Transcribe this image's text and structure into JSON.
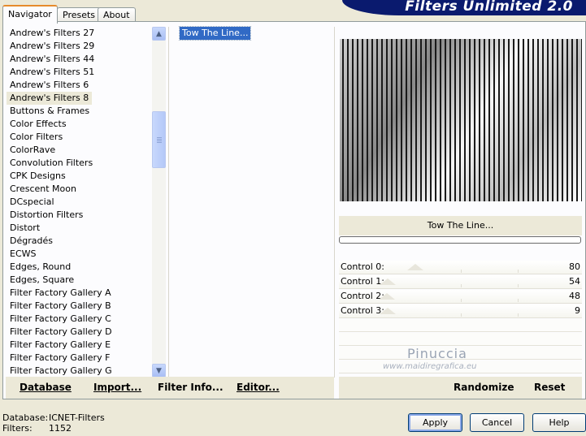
{
  "tabs": [
    {
      "label": "Navigator"
    },
    {
      "label": "Presets"
    },
    {
      "label": "About"
    }
  ],
  "banner": {
    "title": "Filters Unlimited 2.0"
  },
  "categories": [
    "Andrew's Filters 27",
    "Andrew's Filters 29",
    "Andrew's Filters 44",
    "Andrew's Filters 51",
    "Andrew's Filters 6",
    "Andrew's Filters 8",
    "Buttons & Frames",
    "Color Effects",
    "Color Filters",
    "ColorRave",
    "Convolution Filters",
    "CPK Designs",
    "Crescent Moon",
    "DCspecial",
    "Distortion Filters",
    "Distort",
    "Dégradés",
    "ECWS",
    "Edges, Round",
    "Edges, Square",
    "Filter Factory Gallery A",
    "Filter Factory Gallery B",
    "Filter Factory Gallery C",
    "Filter Factory Gallery D",
    "Filter Factory Gallery E",
    "Filter Factory Gallery F",
    "Filter Factory Gallery G"
  ],
  "selected_category": "Andrew's Filters 8",
  "filter_list": {
    "selected": "Tow The Line..."
  },
  "preview": {
    "filter_name": "Tow The Line..."
  },
  "controls": [
    {
      "label": "Control 0:",
      "value": "80"
    },
    {
      "label": "Control 1:",
      "value": "54"
    },
    {
      "label": "Control 2:",
      "value": "48"
    },
    {
      "label": "Control 3:",
      "value": "9"
    }
  ],
  "watermark": {
    "name": "Pinuccia",
    "site": "www.maidiregrafica.eu"
  },
  "left_buttons": {
    "database": "Database",
    "import": "Import...",
    "filter_info": "Filter Info...",
    "editor": "Editor..."
  },
  "right_buttons": {
    "randomize": "Randomize",
    "reset": "Reset"
  },
  "status": {
    "database_label": "Database:",
    "database_value": "ICNET-Filters",
    "filters_label": "Filters:",
    "filters_value": "1152"
  },
  "dialog_buttons": {
    "apply": "Apply",
    "cancel": "Cancel",
    "help": "Help"
  },
  "colors": {
    "selection": "#316ac5",
    "banner": "#0a1a6e",
    "face": "#ece9d8"
  }
}
